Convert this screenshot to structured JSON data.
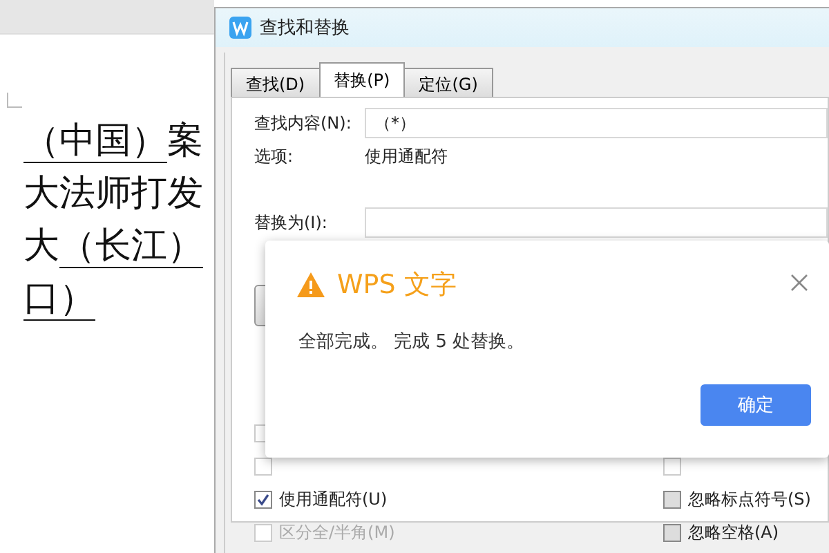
{
  "document": {
    "lines": [
      [
        {
          "text": "（中国）",
          "underlined": true
        },
        {
          "text": "案",
          "underlined": false
        }
      ],
      [
        {
          "text": "大法师打发",
          "underlined": false
        }
      ],
      [
        {
          "text": "大",
          "underlined": false
        },
        {
          "text": "（长江）",
          "underlined": true
        }
      ],
      [
        {
          "text": "口）",
          "underlined": true
        }
      ]
    ]
  },
  "find_replace_dialog": {
    "title": "查找和替换",
    "tabs": [
      {
        "label": "查找(D)",
        "selected": false
      },
      {
        "label": "替换(P)",
        "selected": true
      },
      {
        "label": "定位(G)",
        "selected": false
      }
    ],
    "find_label": "查找内容(N):",
    "find_value": "（*）",
    "options_label": "选项:",
    "options_value": "使用通配符",
    "replace_label": "替换为(I):",
    "checkboxes_left": [
      {
        "checked": false,
        "disabled": true
      },
      {
        "checked": false,
        "disabled": true
      },
      {
        "label": "使用通配符(U)",
        "checked": true,
        "disabled": false
      },
      {
        "label": "区分全/半角(M)",
        "checked": false,
        "disabled": true
      }
    ],
    "checkboxes_right": [
      {
        "checked": false,
        "disabled": true
      },
      {
        "label": "忽略标点符号(S)",
        "checked": false,
        "disabled": false
      },
      {
        "label": "忽略空格(A)",
        "checked": false,
        "disabled": false
      }
    ]
  },
  "message_box": {
    "title": "WPS 文字",
    "message": "全部完成。 完成 5 处替换。",
    "button": "确定"
  }
}
